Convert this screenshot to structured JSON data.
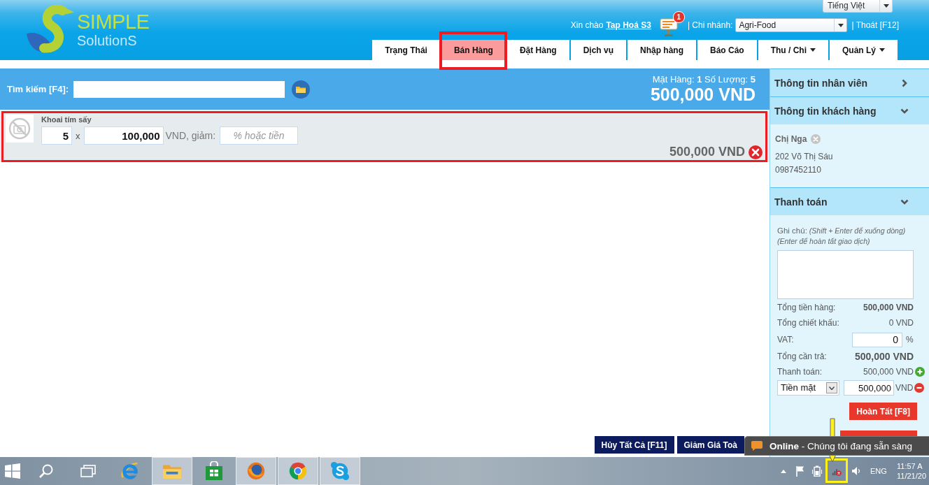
{
  "header": {
    "logo": {
      "title": "SIMPLE",
      "subtitle": "SolutionS"
    },
    "language": "Tiếng Việt",
    "greeting": "Xin chào",
    "user": "Tap Hoá S3",
    "notification_count": "1",
    "branch_label": "| Chi nhánh:",
    "branch": "Agri-Food",
    "logout": "| Thoát [F12]"
  },
  "nav_tabs": [
    {
      "label": "Trạng Thái",
      "selected": false,
      "highlighted": false,
      "dropdown": false
    },
    {
      "label": "Bán Hàng",
      "selected": true,
      "highlighted": true,
      "dropdown": false
    },
    {
      "label": "Đặt Hàng",
      "selected": false,
      "highlighted": false,
      "dropdown": false
    },
    {
      "label": "Dịch vụ",
      "selected": false,
      "highlighted": false,
      "dropdown": false
    },
    {
      "label": "Nhập hàng",
      "selected": false,
      "highlighted": false,
      "dropdown": false
    },
    {
      "label": "Báo Cáo",
      "selected": false,
      "highlighted": false,
      "dropdown": false
    },
    {
      "label": "Thu / Chi",
      "selected": false,
      "highlighted": false,
      "dropdown": true
    },
    {
      "label": "Quản Lý",
      "selected": false,
      "highlighted": false,
      "dropdown": true
    }
  ],
  "search": {
    "label": "Tìm kiếm [F4]:"
  },
  "summary": {
    "counts": "Mặt Hàng: **1** Số Lượng: **5**",
    "total": "500,000 VND"
  },
  "cart_items": [
    {
      "name": "Khoai tím sấy",
      "quantity": "5",
      "times": "x",
      "price": "100,000",
      "discount_label": "VND, giảm:",
      "discount_placeholder": "% hoặc tiền",
      "line_total": "500,000 VND",
      "highlighted": true
    }
  ],
  "bottom_buttons": [
    {
      "label": "Hủy Tất Cả [F11]"
    },
    {
      "label": "Giảm Giá Toà"
    }
  ],
  "sidebar": {
    "panels": [
      {
        "title": "Thông tin nhân viên",
        "expanded": false
      },
      {
        "kind": "customer",
        "title": "Thông tin khách hàng",
        "expanded": true,
        "name": "Chị Nga",
        "address": "202 Võ Thị Sáu",
        "phone": "0987452110"
      },
      {
        "kind": "payment",
        "title": "Thanh toán",
        "expanded": true,
        "note_label": "Ghi chú:",
        "note_hints": [
          "(Shift + Enter để xuống dòng)",
          "(Enter để hoàn tất giao dịch)"
        ],
        "rows": [
          {
            "kind": "amount",
            "label": "Tổng tiền hàng:",
            "value": "500,000 VND",
            "bold": true
          },
          {
            "kind": "amount",
            "label": "Tổng chiết khấu:",
            "value": "0 VND",
            "bold": false
          },
          {
            "kind": "input",
            "label": "VAT:",
            "value": "0",
            "unit": "%"
          },
          {
            "kind": "grand",
            "label": "Tổng cần trả:",
            "value": "500,000 VND"
          },
          {
            "kind": "paid",
            "label": "Thanh toán:",
            "value": "500,000 VND"
          }
        ],
        "payment_lines": [
          {
            "method": "Tiền mặt",
            "amount": "500,000",
            "unit": "VND"
          }
        ],
        "actions": [
          {
            "kind": "full",
            "label": "Hoàn Tất [F8]"
          },
          {
            "kind": "covered"
          }
        ]
      }
    ]
  },
  "chat": {
    "text": "**Online** - Chúng tôi đang sẵn sàng"
  },
  "taskbar": {
    "apps": [
      {
        "kind": "start",
        "running": false
      },
      {
        "kind": "search",
        "running": false
      },
      {
        "kind": "taskview",
        "running": false
      },
      {
        "kind": "ie",
        "running": false
      },
      {
        "kind": "explorer",
        "running": true
      },
      {
        "kind": "store",
        "running": false
      },
      {
        "kind": "firefox",
        "running": true
      },
      {
        "kind": "chrome",
        "running": true
      },
      {
        "kind": "skype",
        "running": true
      }
    ],
    "tray": [
      {
        "kind": "chevron",
        "highlighted": false
      },
      {
        "kind": "flag",
        "highlighted": false
      },
      {
        "kind": "battery",
        "highlighted": false
      },
      {
        "kind": "network",
        "highlighted": true
      },
      {
        "kind": "speaker",
        "highlighted": false
      }
    ],
    "language": "ENG",
    "time": "11:57 A",
    "date": "11/21/20"
  }
}
